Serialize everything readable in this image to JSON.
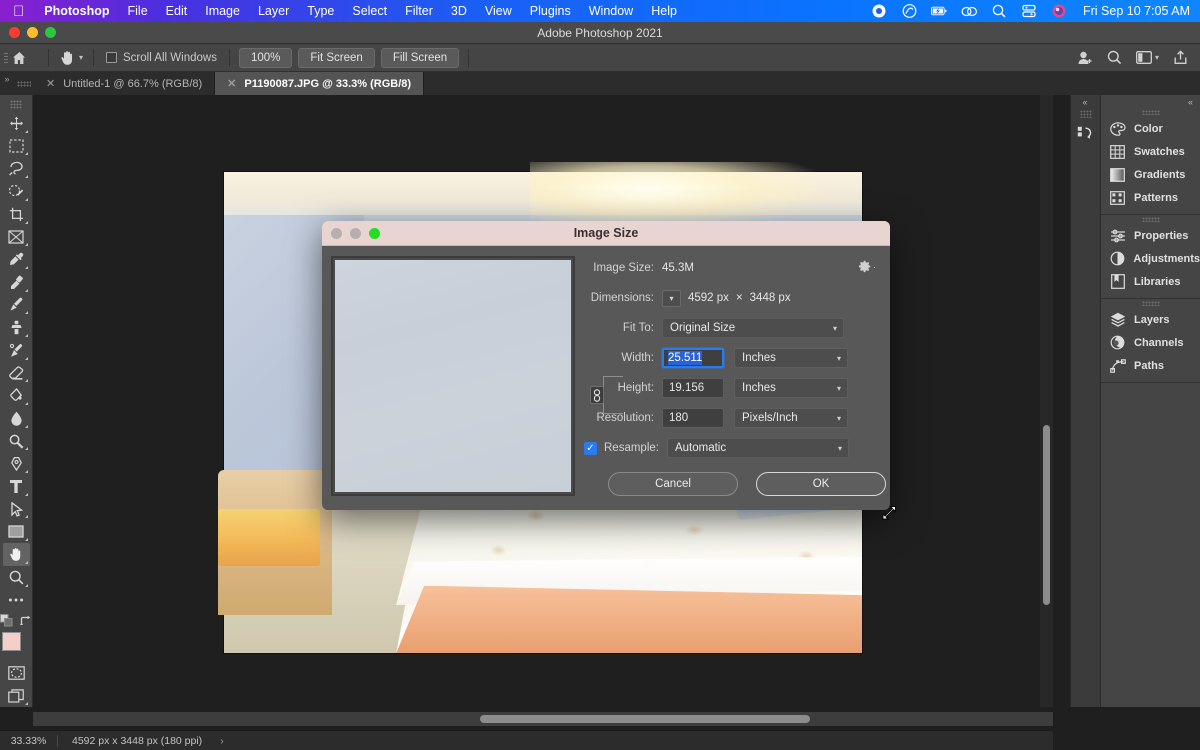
{
  "menubar": {
    "apple_icon": "apple-logo-icon",
    "items": [
      {
        "label": "Photoshop",
        "bold": true
      },
      {
        "label": "File",
        "bold": false
      },
      {
        "label": "Edit",
        "bold": false
      },
      {
        "label": "Image",
        "bold": false
      },
      {
        "label": "Layer",
        "bold": false
      },
      {
        "label": "Type",
        "bold": false
      },
      {
        "label": "Select",
        "bold": false
      },
      {
        "label": "Filter",
        "bold": false
      },
      {
        "label": "3D",
        "bold": false
      },
      {
        "label": "View",
        "bold": false
      },
      {
        "label": "Plugins",
        "bold": false
      },
      {
        "label": "Window",
        "bold": false
      },
      {
        "label": "Help",
        "bold": false
      }
    ],
    "status_icons": [
      "record-icon",
      "creative-cloud-icon",
      "battery-charging-icon",
      "airdrop-icon",
      "search-icon",
      "control-center-icon",
      "user-avatar-icon"
    ],
    "clock": "Fri Sep 10  7:05 AM"
  },
  "window": {
    "title": "Adobe Photoshop 2021",
    "traffic_lights": [
      "close",
      "minimize",
      "zoom"
    ]
  },
  "options_bar": {
    "home_icon": "home-icon",
    "tool_icon": "hand-tool-icon",
    "scroll_all_label": "Scroll All Windows",
    "scroll_all_checked": false,
    "buttons": [
      "100%",
      "Fit Screen",
      "Fill Screen"
    ],
    "right_icons": [
      "share-user-icon",
      "search-icon",
      "workspace-icon",
      "export-icon"
    ]
  },
  "tabs": [
    {
      "label": "Untitled-1 @ 66.7% (RGB/8)",
      "active": false
    },
    {
      "label": "P1190087.JPG @ 33.3% (RGB/8)",
      "active": true
    }
  ],
  "toolbar": {
    "tools": [
      {
        "name": "move-tool",
        "glyph": "move",
        "selected": false
      },
      {
        "name": "marquee-tool",
        "glyph": "marquee",
        "selected": false
      },
      {
        "name": "lasso-tool",
        "glyph": "lasso",
        "selected": false
      },
      {
        "name": "object-selection-tool",
        "glyph": "objsel",
        "selected": false
      },
      {
        "name": "crop-tool",
        "glyph": "crop",
        "selected": false
      },
      {
        "name": "frame-tool",
        "glyph": "frame",
        "selected": false
      },
      {
        "name": "eyedropper-tool",
        "glyph": "eyedropper",
        "selected": false
      },
      {
        "name": "healing-brush-tool",
        "glyph": "healing",
        "selected": false
      },
      {
        "name": "brush-tool",
        "glyph": "brush",
        "selected": false
      },
      {
        "name": "clone-stamp-tool",
        "glyph": "stamp",
        "selected": false
      },
      {
        "name": "history-brush-tool",
        "glyph": "historybrush",
        "selected": false
      },
      {
        "name": "eraser-tool",
        "glyph": "eraser",
        "selected": false
      },
      {
        "name": "gradient-tool",
        "glyph": "bucket",
        "selected": false
      },
      {
        "name": "blur-tool",
        "glyph": "blur",
        "selected": false
      },
      {
        "name": "dodge-tool",
        "glyph": "dodge",
        "selected": false
      },
      {
        "name": "pen-tool",
        "glyph": "pen",
        "selected": false
      },
      {
        "name": "type-tool",
        "glyph": "type",
        "selected": false
      },
      {
        "name": "path-selection-tool",
        "glyph": "pathsel",
        "selected": false
      },
      {
        "name": "rectangle-tool",
        "glyph": "rect",
        "selected": false
      },
      {
        "name": "hand-tool",
        "glyph": "hand",
        "selected": true
      },
      {
        "name": "zoom-tool",
        "glyph": "zoom",
        "selected": false
      },
      {
        "name": "edit-toolbar",
        "glyph": "dots",
        "selected": false
      }
    ],
    "foreground_color": "#f2cfc9",
    "background_color": "#a8a8a8"
  },
  "canvas": {
    "document_name": "P1190087.JPG",
    "photo_alt": "bedroom interior with blue walls, shell-pattern quilt, peach bed skirt and wicker chair"
  },
  "status_bar": {
    "zoom": "33.33%",
    "doc_info": "4592 px x 3448 px (180 ppi)",
    "expand_arrow": "›"
  },
  "right_dock": {
    "collapse_label": "«",
    "icon_column": [
      "history-actions-icon"
    ],
    "groups": [
      {
        "items": [
          {
            "label": "Color",
            "icon": "color-palette-icon"
          },
          {
            "label": "Swatches",
            "icon": "swatches-grid-icon"
          },
          {
            "label": "Gradients",
            "icon": "gradient-icon"
          },
          {
            "label": "Patterns",
            "icon": "patterns-icon"
          }
        ]
      },
      {
        "items": [
          {
            "label": "Properties",
            "icon": "properties-sliders-icon"
          },
          {
            "label": "Adjustments",
            "icon": "adjustments-halfcircle-icon"
          },
          {
            "label": "Libraries",
            "icon": "libraries-book-icon"
          }
        ]
      },
      {
        "items": [
          {
            "label": "Layers",
            "icon": "layers-stack-icon"
          },
          {
            "label": "Channels",
            "icon": "channels-circle-icon"
          },
          {
            "label": "Paths",
            "icon": "paths-anchor-icon"
          }
        ]
      }
    ]
  },
  "dialog": {
    "title": "Image Size",
    "traffic_lights": [
      "close",
      "minimize",
      "zoom"
    ],
    "image_size": {
      "label": "Image Size:",
      "value": "45.3M"
    },
    "gear_icon": "settings-gear-icon",
    "dimensions": {
      "label": "Dimensions:",
      "chevron": "chevron-down-icon",
      "width": "4592 px",
      "separator": "×",
      "height": "3448 px"
    },
    "fit_to": {
      "label": "Fit To:",
      "value": "Original Size"
    },
    "constrain_icon": "chain-link-icon",
    "width": {
      "label": "Width:",
      "value": "25.511",
      "unit": "Inches",
      "focused": true,
      "selected": true
    },
    "height": {
      "label": "Height:",
      "value": "19.156",
      "unit": "Inches"
    },
    "resolution": {
      "label": "Resolution:",
      "value": "180",
      "unit": "Pixels/Inch"
    },
    "resample": {
      "label": "Resample:",
      "value": "Automatic",
      "checked": true
    },
    "cancel_label": "Cancel",
    "ok_label": "OK",
    "cursor_icon": "resize-diagonal-cursor"
  },
  "colors": {
    "dialog_titlebar": "#e8d5d2",
    "accent_blue": "#2a7bf0",
    "selection_blue": "#2a63d8",
    "panel_bg": "#454545",
    "canvas_bg": "#1f1f1f"
  }
}
